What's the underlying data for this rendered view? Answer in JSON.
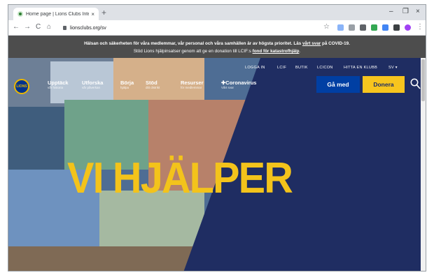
{
  "browser": {
    "tab_title": "Home page | Lions Clubs Internat",
    "tab_close": "×",
    "new_tab": "+",
    "minimize": "–",
    "maximize": "❐",
    "close": "×",
    "back": "←",
    "forward": "→",
    "reload": "C",
    "home": "⌂",
    "url": "lionsclubs.org/sv",
    "star": "☆"
  },
  "notice": {
    "line1_before": "Hälsan och säkerheten för våra medlemmar, vår personal och våra samhällen är av högsta prioritet. Läs ",
    "line1_link": "vårt svar",
    "line1_after": " på COVID-19.",
    "line2_before": "Stöd Lions hjälpinsatser genom att ge en donation till LCIF:s ",
    "line2_link": "fond för katastrofhjälp",
    "line2_after": "."
  },
  "site": {
    "logo_text": "LIONS",
    "utility": [
      "LOGGA IN",
      "LCIF",
      "BUTIK",
      "LCICON",
      "HITTA EN KLUBB",
      "SV ▾"
    ],
    "nav": [
      {
        "title": "Upptäck",
        "sub": "vår historia"
      },
      {
        "title": "Utforska",
        "sub": "vår påverkan"
      },
      {
        "title": "Börja",
        "sub": "hjälpa"
      },
      {
        "title": "Stöd",
        "sub": "ditt distrikt"
      },
      {
        "title": "Resurser",
        "sub": "för medlemmar"
      },
      {
        "title": "✚Coronavirus",
        "sub": "Vårt svar"
      }
    ],
    "join_label": "Gå med",
    "donate_label": "Donera",
    "headline": "VI HJÄLPER"
  },
  "colors": {
    "navy": "#1f2d62",
    "yellow": "#f7c51e",
    "join_blue": "#003fa3",
    "notice_bg": "#4d4d4d"
  }
}
